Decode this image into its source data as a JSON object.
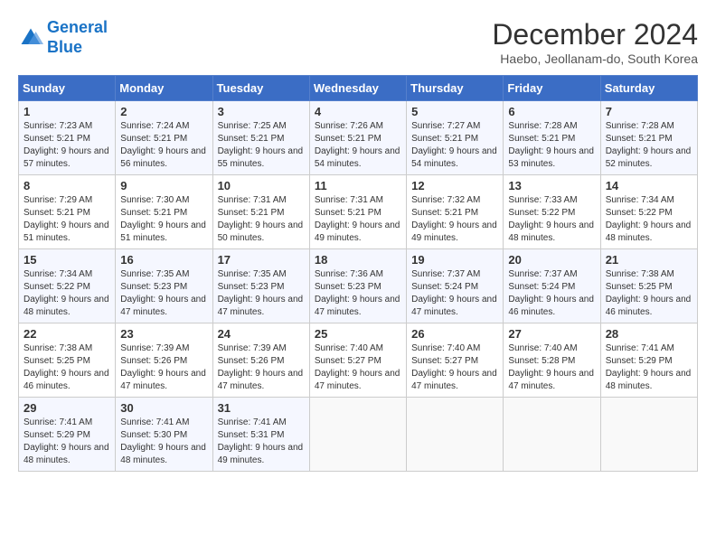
{
  "logo": {
    "line1": "General",
    "line2": "Blue"
  },
  "title": "December 2024",
  "subtitle": "Haebo, Jeollanam-do, South Korea",
  "days_header": [
    "Sunday",
    "Monday",
    "Tuesday",
    "Wednesday",
    "Thursday",
    "Friday",
    "Saturday"
  ],
  "weeks": [
    [
      {
        "day": "1",
        "sunrise": "7:23 AM",
        "sunset": "5:21 PM",
        "daylight": "9 hours and 57 minutes."
      },
      {
        "day": "2",
        "sunrise": "7:24 AM",
        "sunset": "5:21 PM",
        "daylight": "9 hours and 56 minutes."
      },
      {
        "day": "3",
        "sunrise": "7:25 AM",
        "sunset": "5:21 PM",
        "daylight": "9 hours and 55 minutes."
      },
      {
        "day": "4",
        "sunrise": "7:26 AM",
        "sunset": "5:21 PM",
        "daylight": "9 hours and 54 minutes."
      },
      {
        "day": "5",
        "sunrise": "7:27 AM",
        "sunset": "5:21 PM",
        "daylight": "9 hours and 54 minutes."
      },
      {
        "day": "6",
        "sunrise": "7:28 AM",
        "sunset": "5:21 PM",
        "daylight": "9 hours and 53 minutes."
      },
      {
        "day": "7",
        "sunrise": "7:28 AM",
        "sunset": "5:21 PM",
        "daylight": "9 hours and 52 minutes."
      }
    ],
    [
      {
        "day": "8",
        "sunrise": "7:29 AM",
        "sunset": "5:21 PM",
        "daylight": "9 hours and 51 minutes."
      },
      {
        "day": "9",
        "sunrise": "7:30 AM",
        "sunset": "5:21 PM",
        "daylight": "9 hours and 51 minutes."
      },
      {
        "day": "10",
        "sunrise": "7:31 AM",
        "sunset": "5:21 PM",
        "daylight": "9 hours and 50 minutes."
      },
      {
        "day": "11",
        "sunrise": "7:31 AM",
        "sunset": "5:21 PM",
        "daylight": "9 hours and 49 minutes."
      },
      {
        "day": "12",
        "sunrise": "7:32 AM",
        "sunset": "5:21 PM",
        "daylight": "9 hours and 49 minutes."
      },
      {
        "day": "13",
        "sunrise": "7:33 AM",
        "sunset": "5:22 PM",
        "daylight": "9 hours and 48 minutes."
      },
      {
        "day": "14",
        "sunrise": "7:34 AM",
        "sunset": "5:22 PM",
        "daylight": "9 hours and 48 minutes."
      }
    ],
    [
      {
        "day": "15",
        "sunrise": "7:34 AM",
        "sunset": "5:22 PM",
        "daylight": "9 hours and 48 minutes."
      },
      {
        "day": "16",
        "sunrise": "7:35 AM",
        "sunset": "5:23 PM",
        "daylight": "9 hours and 47 minutes."
      },
      {
        "day": "17",
        "sunrise": "7:35 AM",
        "sunset": "5:23 PM",
        "daylight": "9 hours and 47 minutes."
      },
      {
        "day": "18",
        "sunrise": "7:36 AM",
        "sunset": "5:23 PM",
        "daylight": "9 hours and 47 minutes."
      },
      {
        "day": "19",
        "sunrise": "7:37 AM",
        "sunset": "5:24 PM",
        "daylight": "9 hours and 47 minutes."
      },
      {
        "day": "20",
        "sunrise": "7:37 AM",
        "sunset": "5:24 PM",
        "daylight": "9 hours and 46 minutes."
      },
      {
        "day": "21",
        "sunrise": "7:38 AM",
        "sunset": "5:25 PM",
        "daylight": "9 hours and 46 minutes."
      }
    ],
    [
      {
        "day": "22",
        "sunrise": "7:38 AM",
        "sunset": "5:25 PM",
        "daylight": "9 hours and 46 minutes."
      },
      {
        "day": "23",
        "sunrise": "7:39 AM",
        "sunset": "5:26 PM",
        "daylight": "9 hours and 47 minutes."
      },
      {
        "day": "24",
        "sunrise": "7:39 AM",
        "sunset": "5:26 PM",
        "daylight": "9 hours and 47 minutes."
      },
      {
        "day": "25",
        "sunrise": "7:40 AM",
        "sunset": "5:27 PM",
        "daylight": "9 hours and 47 minutes."
      },
      {
        "day": "26",
        "sunrise": "7:40 AM",
        "sunset": "5:27 PM",
        "daylight": "9 hours and 47 minutes."
      },
      {
        "day": "27",
        "sunrise": "7:40 AM",
        "sunset": "5:28 PM",
        "daylight": "9 hours and 47 minutes."
      },
      {
        "day": "28",
        "sunrise": "7:41 AM",
        "sunset": "5:29 PM",
        "daylight": "9 hours and 48 minutes."
      }
    ],
    [
      {
        "day": "29",
        "sunrise": "7:41 AM",
        "sunset": "5:29 PM",
        "daylight": "9 hours and 48 minutes."
      },
      {
        "day": "30",
        "sunrise": "7:41 AM",
        "sunset": "5:30 PM",
        "daylight": "9 hours and 48 minutes."
      },
      {
        "day": "31",
        "sunrise": "7:41 AM",
        "sunset": "5:31 PM",
        "daylight": "9 hours and 49 minutes."
      },
      null,
      null,
      null,
      null
    ]
  ]
}
